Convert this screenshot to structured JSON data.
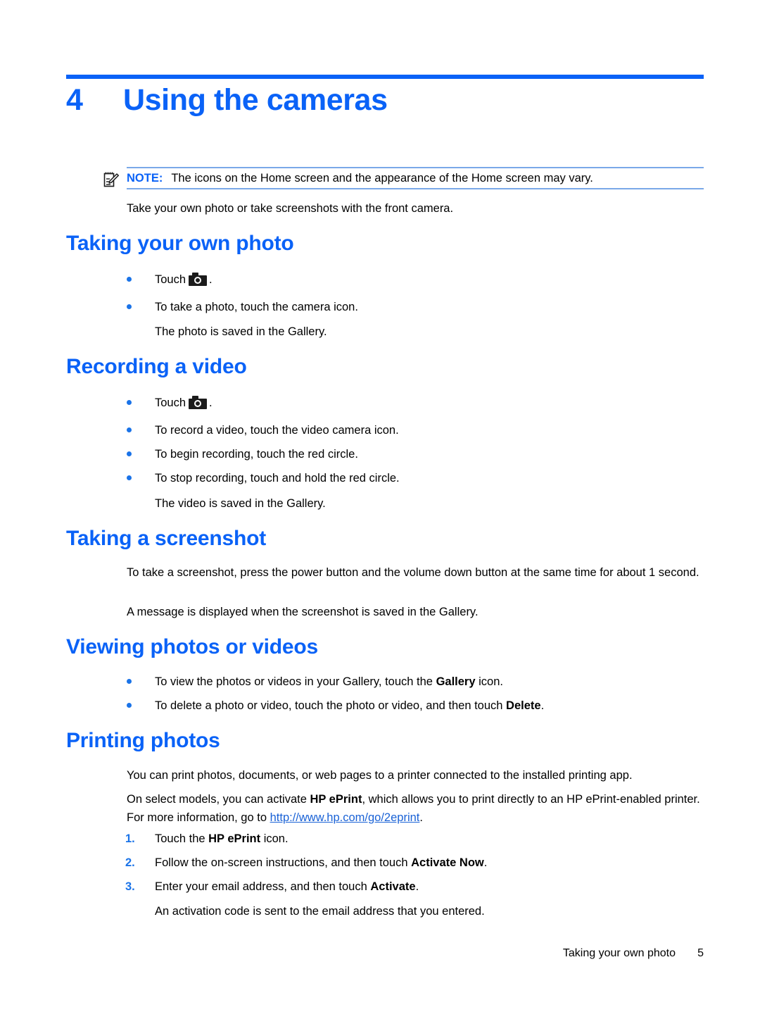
{
  "document": {
    "type": "user-guide-page",
    "accent_color": "#0a62f7",
    "bullet_color": "#1a73e8",
    "text_color": "#000000"
  },
  "chapter": {
    "number": "4",
    "title": "Using the cameras"
  },
  "note": {
    "icon": "note-pencil-icon",
    "label": "NOTE:",
    "text": "The icons on the Home screen and the appearance of the Home screen may vary."
  },
  "intro": {
    "text": "Take your own photo or take screenshots with the front camera."
  },
  "sections": [
    {
      "heading": "Taking your own photo",
      "bullets": [
        {
          "pre": "Touch",
          "icon": "camera-icon",
          "post": "."
        },
        {
          "text": "To take a photo, touch the camera icon."
        }
      ],
      "follow": "The photo is saved in the Gallery."
    },
    {
      "heading": "Recording a video",
      "bullets": [
        {
          "pre": "Touch",
          "icon": "camera-icon",
          "post": "."
        },
        {
          "text": "To record a video, touch the video camera icon."
        },
        {
          "text": "To begin recording, touch the red circle."
        },
        {
          "text": "To stop recording, touch and hold the red circle."
        }
      ],
      "follow": "The video is saved in the Gallery."
    },
    {
      "heading": "Taking a screenshot",
      "paragraphs": [
        "To take a screenshot, press the power button and the volume down button at the same time for about 1 second.",
        "A message is displayed when the screenshot is saved in the Gallery."
      ]
    },
    {
      "heading": "Viewing photos or videos",
      "bullets": [
        {
          "pre": "To view the photos or videos in your Gallery, touch the ",
          "bold": "Gallery",
          "post": " icon."
        },
        {
          "pre": "To delete a photo or video, touch the photo or video, and then touch ",
          "bold": "Delete",
          "post": "."
        }
      ]
    },
    {
      "heading": "Printing photos",
      "paragraph1": "You can print photos, documents, or web pages to a printer connected to the installed printing app.",
      "paragraph2_a": "On select models, you can activate ",
      "paragraph2_bold": "HP ePrint",
      "paragraph2_b": ", which allows you to print directly to an HP ePrint-enabled printer. For more information, go to ",
      "paragraph2_link": "http://www.hp.com/go/2eprint",
      "paragraph2_c": ".",
      "steps": [
        {
          "number": "1.",
          "pre": "Touch the ",
          "bold": "HP ePrint",
          "post": " icon."
        },
        {
          "number": "2.",
          "pre": "Follow the on-screen instructions, and then touch ",
          "bold": "Activate Now",
          "post": "."
        },
        {
          "number": "3.",
          "pre": "Enter your email address, and then touch ",
          "bold": "Activate",
          "post": "."
        }
      ],
      "steps_follow": "An activation code is sent to the email address that you entered."
    }
  ],
  "footer": {
    "running_title": "Taking your own photo",
    "page_number": "5"
  }
}
